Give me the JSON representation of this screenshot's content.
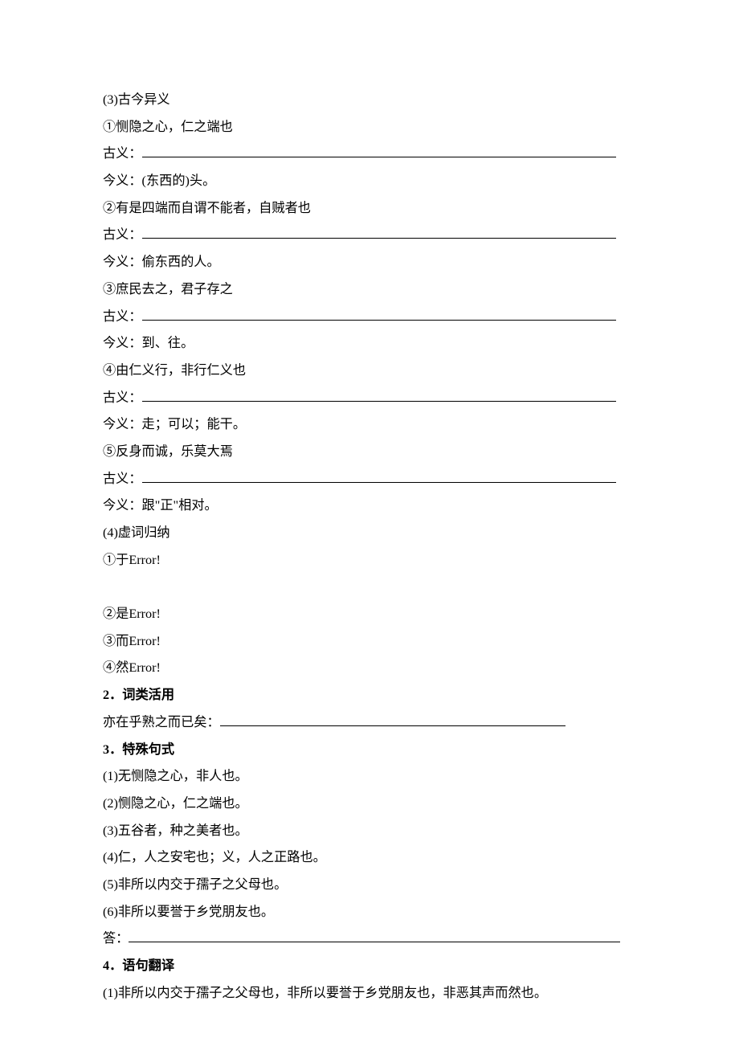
{
  "section3_header": "(3)古今异义",
  "q1_line": "①恻隐之心，仁之端也",
  "gu_label": "古义：",
  "q1_jin": "今义：(东西的)头。",
  "q2_line": "②有是四端而自谓不能者，自贼者也",
  "q2_jin": "今义：偷东西的人。",
  "q3_line": "③庶民去之，君子存之",
  "q3_jin": "今义：到、往。",
  "q4_line": "④由仁义行，非行仁义也",
  "q4_jin": "今义：走；可以；能干。",
  "q5_line": "⑤反身而诚，乐莫大焉",
  "q5_jin": "今义：跟\"正\"相对。",
  "section4_header": "(4)虚词归纳",
  "xu1": "①于Error!",
  "xu2": "②是Error!",
  "xu3": "③而Error!",
  "xu4": "④然Error!",
  "sec2_header": "2．词类活用",
  "sec2_line_prefix": "亦在乎熟之而已矣：",
  "sec3_header": "3．特殊句式",
  "s3_1": "(1)无恻隐之心，非人也。",
  "s3_2": "(2)恻隐之心，仁之端也。",
  "s3_3": "(3)五谷者，种之美者也。",
  "s3_4": "(4)仁，人之安宅也；义，人之正路也。",
  "s3_5": "(5)非所以内交于孺子之父母也。",
  "s3_6": "(6)非所以要誉于乡党朋友也。",
  "ans_label": "答：",
  "sec4_header": "4．语句翻译",
  "s4_1": "(1)非所以内交于孺子之父母也，非所以要誉于乡党朋友也，非恶其声而然也。"
}
